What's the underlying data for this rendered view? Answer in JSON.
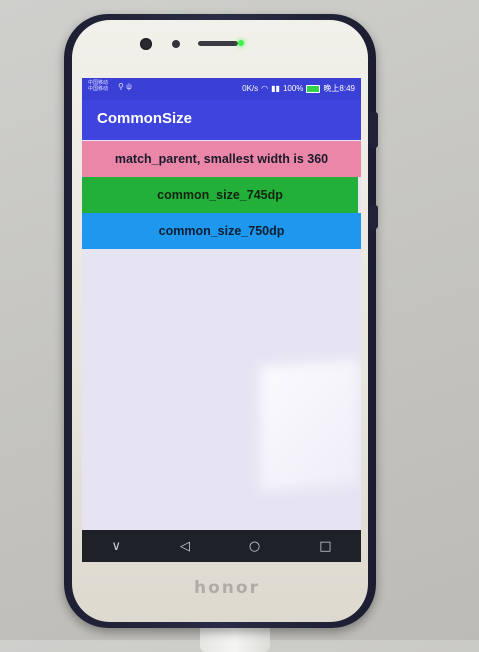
{
  "device": {
    "brand_logo": "honor",
    "led_color": "#3ef24a"
  },
  "status_bar": {
    "carrier_1": "中国移动",
    "carrier_2": "中国移动",
    "net_speed": "0K/s",
    "battery": "100%",
    "time": "晚上8:49"
  },
  "app": {
    "title": "CommonSize",
    "bar_color": "#3e44dd"
  },
  "blocks": [
    {
      "label": "match_parent, smallest width is 360",
      "color": "#ea86a8"
    },
    {
      "label": "common_size_745dp",
      "color": "#22b03a"
    },
    {
      "label": "common_size_750dp",
      "color": "#1d98ee"
    }
  ],
  "nav": {
    "icons": [
      "chevron-down-icon",
      "back-triangle-icon",
      "home-circle-icon",
      "recents-square-icon"
    ],
    "glyphs": [
      "∨",
      "◁",
      "○",
      "□"
    ]
  }
}
